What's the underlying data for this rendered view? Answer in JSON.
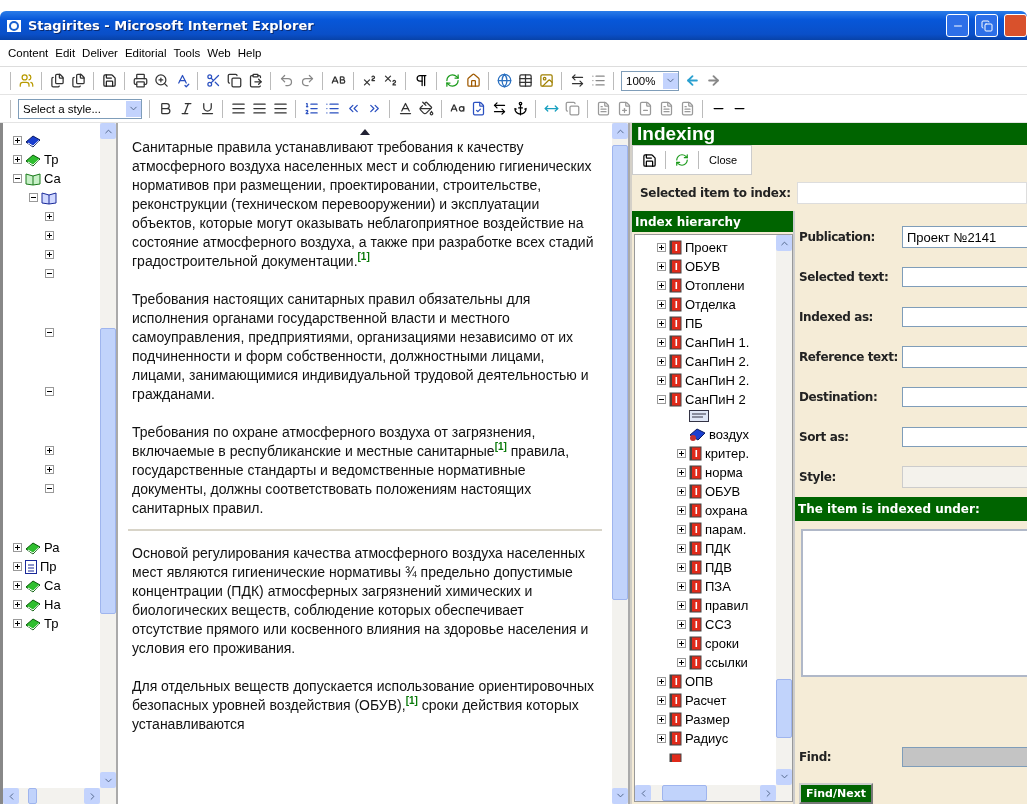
{
  "window": {
    "title": "Stagirites - Microsoft Internet Explorer"
  },
  "menu": [
    "Content",
    "Edit",
    "Deliver",
    "Editorial",
    "Tools",
    "Web",
    "Help"
  ],
  "toolbar": {
    "zoom": "100%",
    "style_select": "Select a style..."
  },
  "nav_tree": [
    {
      "kind": "book-blue",
      "expanded": false
    },
    {
      "kind": "book",
      "label": "Тр",
      "expanded": false
    },
    {
      "kind": "open-book",
      "label": "Са",
      "expanded": true,
      "children": [
        {
          "kind": "open-book-blue",
          "expanded": true,
          "children": [
            {
              "kind": "hidden",
              "expanded": false
            },
            {
              "kind": "hidden",
              "expanded": false
            },
            {
              "kind": "hidden",
              "expanded": false
            },
            {
              "kind": "hidden",
              "expanded": true
            },
            {
              "kind": "hidden",
              "expanded": true
            },
            {
              "kind": "hidden",
              "expanded": true
            },
            {
              "kind": "hidden",
              "expanded": false
            },
            {
              "kind": "hidden",
              "expanded": false
            },
            {
              "kind": "hidden",
              "expanded": true
            }
          ]
        }
      ]
    },
    {
      "kind": "book",
      "label": "Ра",
      "expanded": false
    },
    {
      "kind": "page",
      "label": "Пр",
      "expanded": false
    },
    {
      "kind": "book",
      "label": "Са",
      "expanded": false
    },
    {
      "kind": "book",
      "label": "На",
      "expanded": false
    },
    {
      "kind": "book",
      "label": "Тр",
      "expanded": false
    }
  ],
  "content": [
    {
      "text": "Санитарные правила устанавливают требования к качеству атмосферного воздуха населенных мест и соблюдению гигиенических нормативов при размещении, проектировании, строительстве, реконструкции (техническом перевооружении) и эксплуатации объектов, которые могут оказывать неблагоприятное воздействие на состояние атмосферного воздуха, а также при разработке всех стадий градостроительной документации.$^{[1]}$",
      "divider_before": false
    },
    {
      "text": "Требования настоящих санитарных правил обязательны для исполнения органами государственной власти и местного самоуправления, предприятиями, организациями независимо от их подчиненности и форм собственности, должностными лицами, лицами, занимающимися индивидуальной трудовой деятельностью и гражданами.",
      "divider_before": false
    },
    {
      "text": "Требования по охране атмосферного воздуха от загрязнения, включаемые в республиканские и местные санитарные$^{[1]}$ правила, государственные стандарты и ведомственные нормативные документы, должны соответствовать положениям настоящих санитарных правил.",
      "divider_before": false
    },
    {
      "text": "Основой регулирования качества атмосферного воздуха населенных мест являются гигиенические нормативы ¾ предельно допустимые концентрации (ПДК) атмосферных загрязнений химических и биологических веществ, соблюдение которых обеспечивает отсутствие прямого или косвенного влияния на здоровье населения и условия его проживания.",
      "divider_before": true
    },
    {
      "text": "Для отдельных веществ допускается использование ориентировочных безопасных уровней воздействия (ОБУВ),$^{[1]}$ сроки действия которых устанавливаются",
      "divider_before": false
    }
  ],
  "indexing": {
    "title": "Indexing",
    "close": "Close",
    "selected_label": "Selected item to index:",
    "hierarchy_title": "Index hierarchy",
    "tree": [
      {
        "kind": "index",
        "label": "Проект",
        "expanded": false
      },
      {
        "kind": "index",
        "label": "ОБУВ",
        "expanded": false
      },
      {
        "kind": "index",
        "label": "Отоплени",
        "expanded": false
      },
      {
        "kind": "index",
        "label": "Отделка",
        "expanded": false
      },
      {
        "kind": "index",
        "label": "ПБ",
        "expanded": false
      },
      {
        "kind": "index",
        "label": "СанПиН 1.",
        "expanded": false
      },
      {
        "kind": "index",
        "label": "СанПиН 2.",
        "expanded": false
      },
      {
        "kind": "index",
        "label": "СанПиН 2.",
        "expanded": false
      },
      {
        "kind": "index",
        "label": "СанПиН 2",
        "expanded": true,
        "children": [
          {
            "kind": "note"
          },
          {
            "kind": "topic",
            "label": "воздух"
          },
          {
            "kind": "index",
            "label": "критер.",
            "expanded": false
          },
          {
            "kind": "index",
            "label": "норма",
            "expanded": false
          },
          {
            "kind": "index",
            "label": "ОБУВ",
            "expanded": false
          },
          {
            "kind": "index",
            "label": "охрана",
            "expanded": false
          },
          {
            "kind": "index",
            "label": "парам.",
            "expanded": false
          },
          {
            "kind": "index",
            "label": "ПДК",
            "expanded": false
          },
          {
            "kind": "index",
            "label": "ПДВ",
            "expanded": false
          },
          {
            "kind": "index",
            "label": "ПЗА",
            "expanded": false
          },
          {
            "kind": "index",
            "label": "правил",
            "expanded": false
          },
          {
            "kind": "index",
            "label": "ССЗ",
            "expanded": false
          },
          {
            "kind": "index",
            "label": "сроки",
            "expanded": false
          },
          {
            "kind": "index",
            "label": "ссылки",
            "expanded": false
          }
        ]
      },
      {
        "kind": "index",
        "label": "ОПВ",
        "expanded": false
      },
      {
        "kind": "index",
        "label": "Расчет",
        "expanded": false
      },
      {
        "kind": "index",
        "label": "Размер",
        "expanded": false
      },
      {
        "kind": "index",
        "label": "Радиус",
        "expanded": false
      },
      {
        "kind": "index-stub"
      }
    ],
    "fields": [
      {
        "label": "Publication:",
        "kind": "select",
        "value": "Проект №2141",
        "disabled": false
      },
      {
        "label": "Selected text:",
        "kind": "text",
        "disabled": false
      },
      {
        "label": "Indexed as:",
        "kind": "text",
        "disabled": false
      },
      {
        "label": "Reference text:",
        "kind": "select",
        "disabled": false
      },
      {
        "label": "Destination:",
        "kind": "text",
        "disabled": false
      },
      {
        "label": "Sort as:",
        "kind": "text",
        "disabled": false
      },
      {
        "label": "Style:",
        "kind": "select",
        "disabled": true
      }
    ],
    "indexed_under": "The item is indexed under:",
    "find": {
      "label": "Find:",
      "disabled": true
    },
    "find_button": "Find/Next"
  }
}
